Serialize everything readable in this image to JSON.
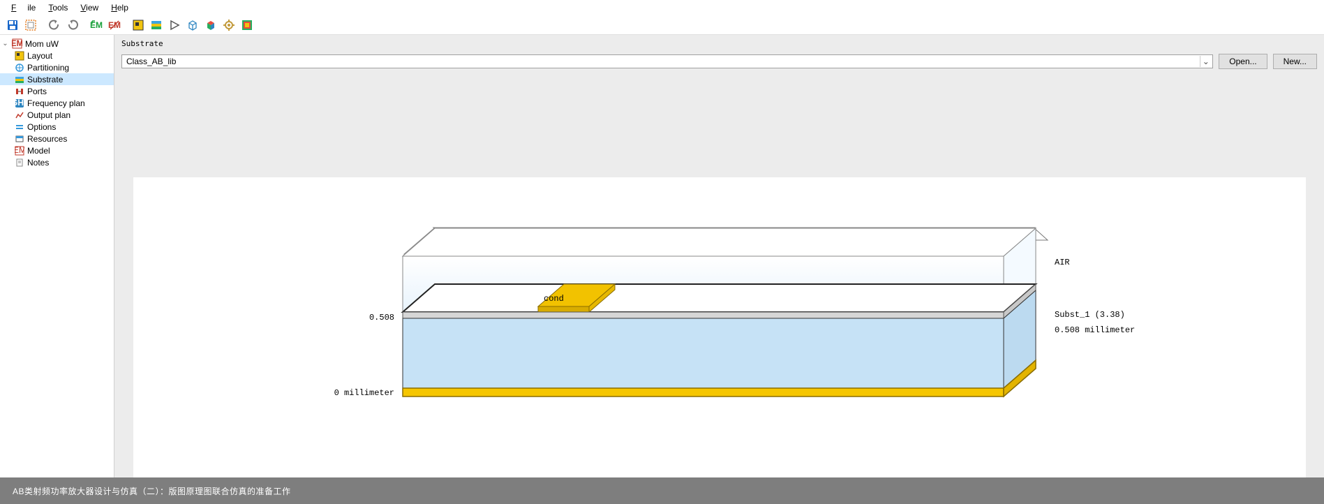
{
  "menu": {
    "file": "File",
    "tools": "Tools",
    "view": "View",
    "help": "Help"
  },
  "tree": {
    "root": "Mom uW",
    "items": [
      {
        "label": "Layout"
      },
      {
        "label": "Partitioning"
      },
      {
        "label": "Substrate"
      },
      {
        "label": "Ports"
      },
      {
        "label": "Frequency plan"
      },
      {
        "label": "Output plan"
      },
      {
        "label": "Options"
      },
      {
        "label": "Resources"
      },
      {
        "label": "Model"
      },
      {
        "label": "Notes"
      }
    ],
    "selected": "Substrate"
  },
  "panel": {
    "title": "Substrate",
    "combo_value": "Class_AB_lib",
    "open_btn": "Open...",
    "new_btn": "New..."
  },
  "diagram": {
    "top_label": "AIR",
    "cond_label": "cond",
    "subst_name": "Subst_1 (3.38)",
    "subst_thickness": "0.508 millimeter",
    "left_top": "0.508",
    "left_bottom": "0 millimeter"
  },
  "caption": "AB类射频功率放大器设计与仿真（二）：版图原理图联合仿真的准备工作"
}
